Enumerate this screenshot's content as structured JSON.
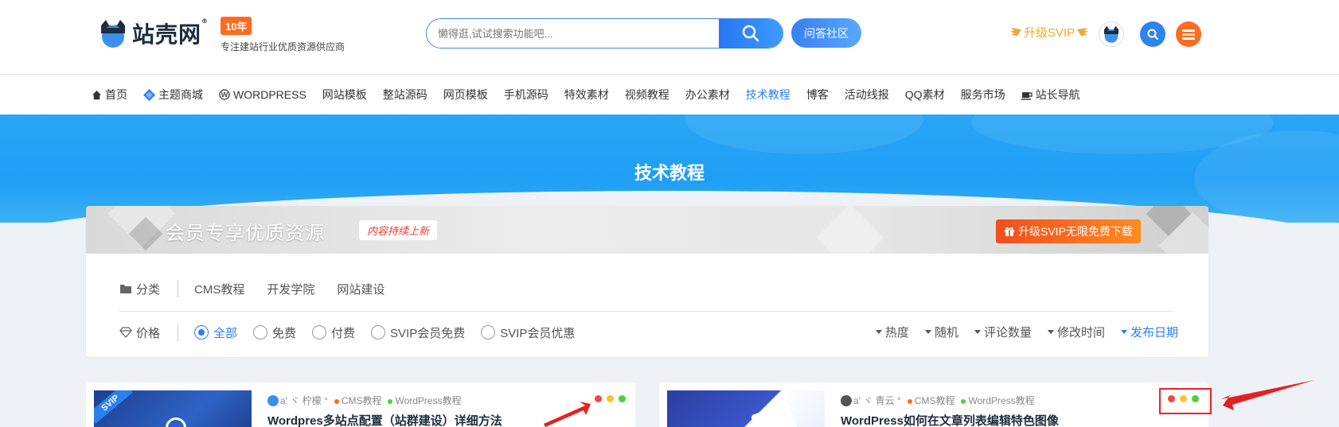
{
  "header": {
    "logo_text": "站壳网",
    "logo_reg": "®",
    "years_badge": "10年",
    "tagline": "专注建站行业优质资源供应商",
    "search_placeholder": "懒得逛,试试搜索功能吧...",
    "qa_button": "问答社区",
    "svip_link": "升级SVIP"
  },
  "nav": {
    "items": [
      {
        "label": "首页",
        "icon": "home-icon"
      },
      {
        "label": "主题商城",
        "icon": "diamond-icon"
      },
      {
        "label": "WORDPRESS",
        "icon": "wordpress-icon"
      },
      {
        "label": "网站模板"
      },
      {
        "label": "整站源码"
      },
      {
        "label": "网页模板"
      },
      {
        "label": "手机源码"
      },
      {
        "label": "特效素材"
      },
      {
        "label": "视频教程"
      },
      {
        "label": "办公素材"
      },
      {
        "label": "技术教程",
        "active": true
      },
      {
        "label": "博客"
      },
      {
        "label": "活动线报"
      },
      {
        "label": "QQ素材"
      },
      {
        "label": "服务市场"
      },
      {
        "label": "站长导航",
        "icon": "coffee-icon"
      }
    ]
  },
  "banner": {
    "title": "技术教程"
  },
  "member": {
    "title": "会员专享优质资源",
    "tag": "内容持续上新",
    "button": "升级SVIP无限免费下载"
  },
  "filters": {
    "category_label": "分类",
    "categories": [
      "CMS教程",
      "开发学院",
      "网站建设"
    ],
    "price_label": "价格",
    "prices": [
      {
        "label": "全部",
        "checked": true
      },
      {
        "label": "免费",
        "checked": false
      },
      {
        "label": "付费",
        "checked": false
      },
      {
        "label": "SVIP会员免费",
        "checked": false
      },
      {
        "label": "SVIP会员优惠",
        "checked": false
      }
    ],
    "sorts": [
      {
        "label": "热度",
        "active": false
      },
      {
        "label": "随机",
        "active": false
      },
      {
        "label": "评论数量",
        "active": false
      },
      {
        "label": "修改时间",
        "active": false
      },
      {
        "label": "发布日期",
        "active": true
      }
    ]
  },
  "posts": [
    {
      "author": "a' ヾ 柠檬 °",
      "cat1": "CMS教程",
      "cat2": "WordPress教程",
      "title": "Wordpres多站点配置（站群建设）详细方法",
      "badge": "SVIP"
    },
    {
      "author": "a' ヾ 青云 °",
      "cat1": "CMS教程",
      "cat2": "WordPress教程",
      "title": "WordPress如何在文章列表编辑特色图像"
    }
  ],
  "colors": {
    "accent": "#2b7ff0",
    "orange": "#ff6a1f",
    "dot_red": "#f5483b",
    "dot_yellow": "#f7c52b",
    "dot_green": "#4cd137",
    "annotation_red": "#e22222"
  }
}
